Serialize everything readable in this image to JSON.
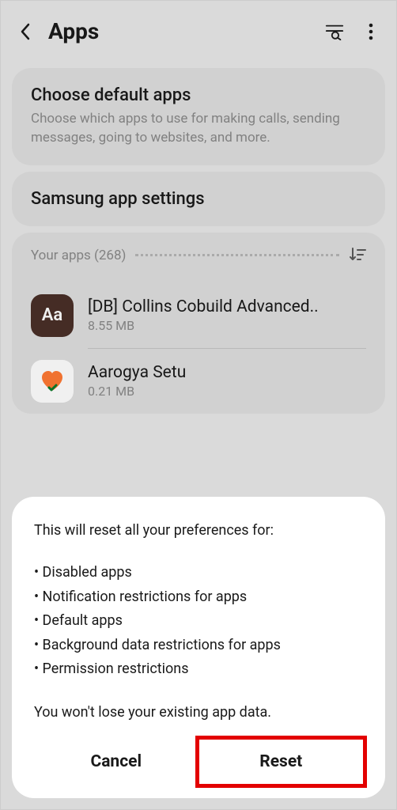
{
  "header": {
    "title": "Apps"
  },
  "cards": {
    "defaultApps": {
      "title": "Choose default apps",
      "subtitle": "Choose which apps to use for making calls, sending messages, going to websites, and more."
    },
    "samsungSettings": {
      "title": "Samsung app settings"
    }
  },
  "yourApps": {
    "label": "Your apps (268)",
    "items": [
      {
        "name": "[DB] Collins Cobuild Advanced..",
        "size": "8.55 MB",
        "iconText": "Aa"
      },
      {
        "name": "Aarogya Setu",
        "size": "0.21 MB"
      }
    ]
  },
  "modal": {
    "title": "This will reset all your preferences for:",
    "bullets": [
      "• Disabled apps",
      "• Notification restrictions for apps",
      "• Default apps",
      "• Background data restrictions for apps",
      "• Permission restrictions"
    ],
    "footerText": "You won't lose your existing app data.",
    "cancelLabel": "Cancel",
    "resetLabel": "Reset"
  }
}
